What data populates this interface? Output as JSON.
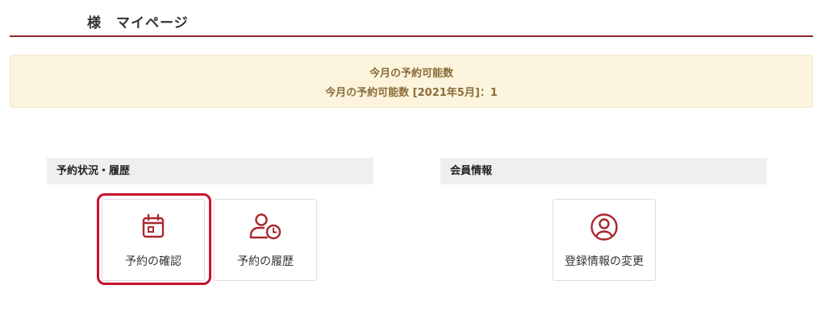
{
  "header": {
    "title": "様　マイページ"
  },
  "notice": {
    "heading": "今月の予約可能数",
    "detail": "今月の予約可能数 [2021年5月]：1"
  },
  "sections": {
    "reservations": {
      "title": "予約状況・履歴",
      "cards": [
        {
          "label": "予約の確認",
          "icon": "calendar-icon"
        },
        {
          "label": "予約の履歴",
          "icon": "user-clock-icon"
        }
      ]
    },
    "member": {
      "title": "会員情報",
      "cards": [
        {
          "label": "登録情報の変更",
          "icon": "user-circle-icon"
        }
      ]
    }
  },
  "colors": {
    "accent": "#8b2a2a",
    "icon": "#a8282f",
    "highlight": "#c8102e",
    "notice_bg": "#fcf4dc",
    "notice_text": "#8a6d3b"
  }
}
